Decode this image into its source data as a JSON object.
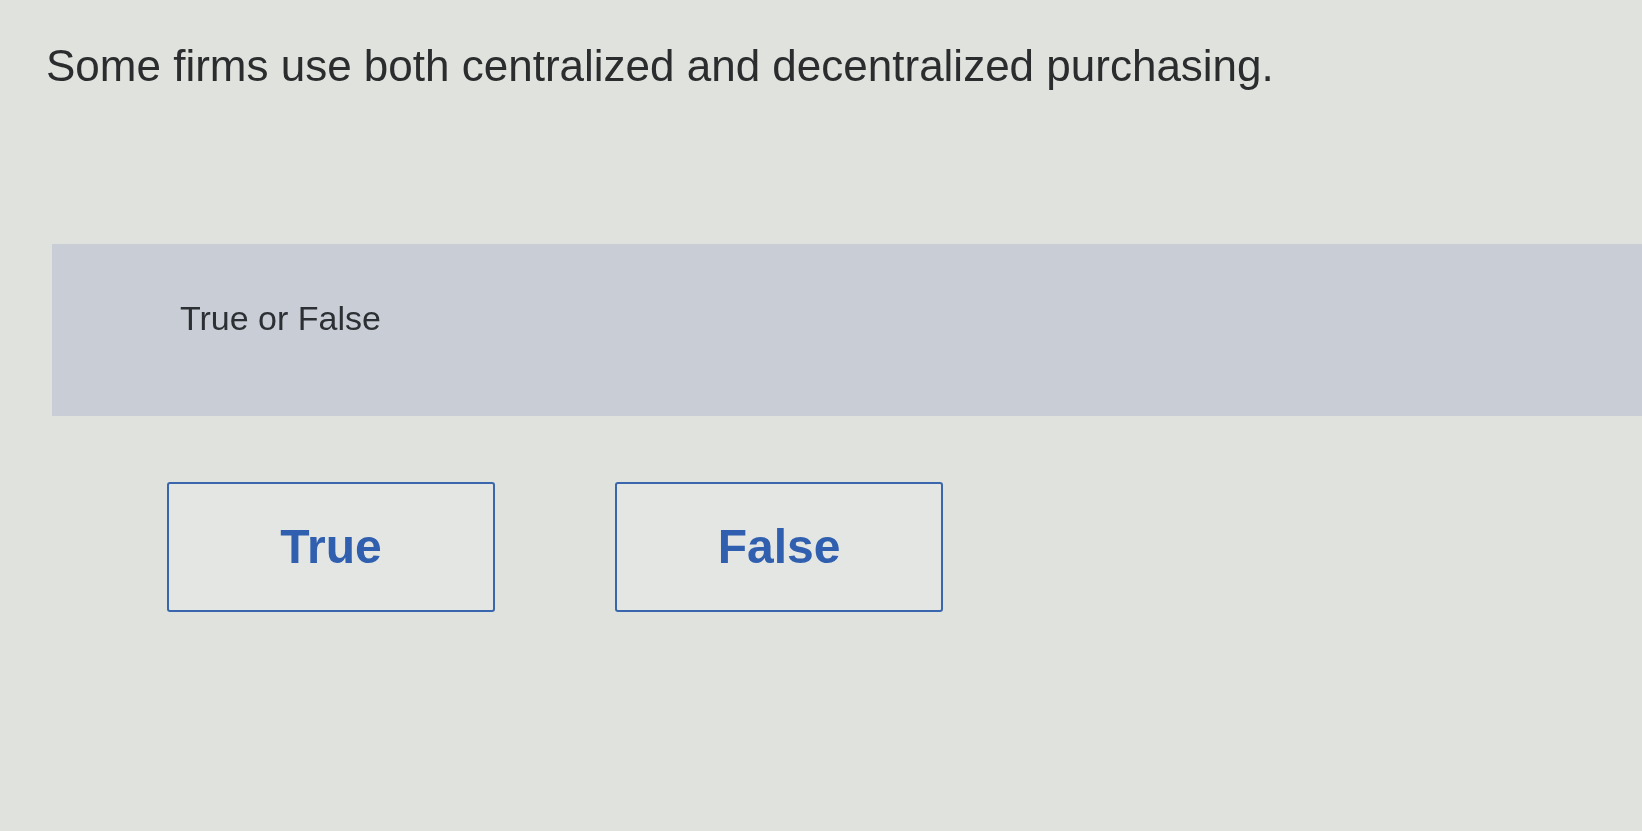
{
  "question": {
    "text": "Some firms use both centralized and decentralized purchasing."
  },
  "prompt": {
    "text": "True or False"
  },
  "options": [
    {
      "label": "True",
      "selected": false
    },
    {
      "label": "False",
      "selected": false
    }
  ]
}
